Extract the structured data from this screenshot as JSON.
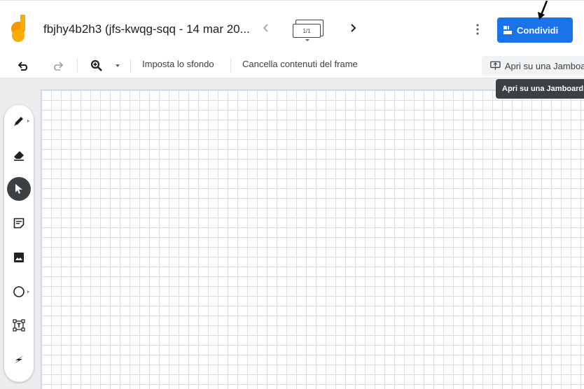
{
  "header": {
    "doc_title": "fbjhy4b2h3 (jfs-kwqg-sqq - 14 mar 20...",
    "frame_counter": "1/1",
    "share_label": "Condividi",
    "colors": {
      "accent": "#1a73e8",
      "logo_yellow": "#f9ab00",
      "logo_orange": "#f29900"
    }
  },
  "toolbar": {
    "undo_icon": "undo-icon",
    "redo_icon": "redo-icon",
    "zoom_icon": "zoom-in-icon",
    "set_background_label": "Imposta lo sfondo",
    "clear_frame_label": "Cancella contenuti del frame",
    "open_jamboard_label": "Apri su una Jamboard"
  },
  "tooltip": {
    "text": "Apri su una Jamboard"
  },
  "tools": [
    {
      "name": "pen-tool",
      "icon": "pen-icon",
      "has_submenu": true,
      "active": false
    },
    {
      "name": "eraser-tool",
      "icon": "eraser-icon",
      "has_submenu": false,
      "active": false
    },
    {
      "name": "select-tool",
      "icon": "cursor-icon",
      "has_submenu": false,
      "active": true
    },
    {
      "name": "sticky-note-tool",
      "icon": "sticky-note-icon",
      "has_submenu": false,
      "active": false
    },
    {
      "name": "image-tool",
      "icon": "image-icon",
      "has_submenu": false,
      "active": false
    },
    {
      "name": "shape-tool",
      "icon": "circle-icon",
      "has_submenu": true,
      "active": false
    },
    {
      "name": "text-box-tool",
      "icon": "text-box-icon",
      "has_submenu": false,
      "active": false
    },
    {
      "name": "laser-tool",
      "icon": "laser-icon",
      "has_submenu": false,
      "active": false
    }
  ]
}
